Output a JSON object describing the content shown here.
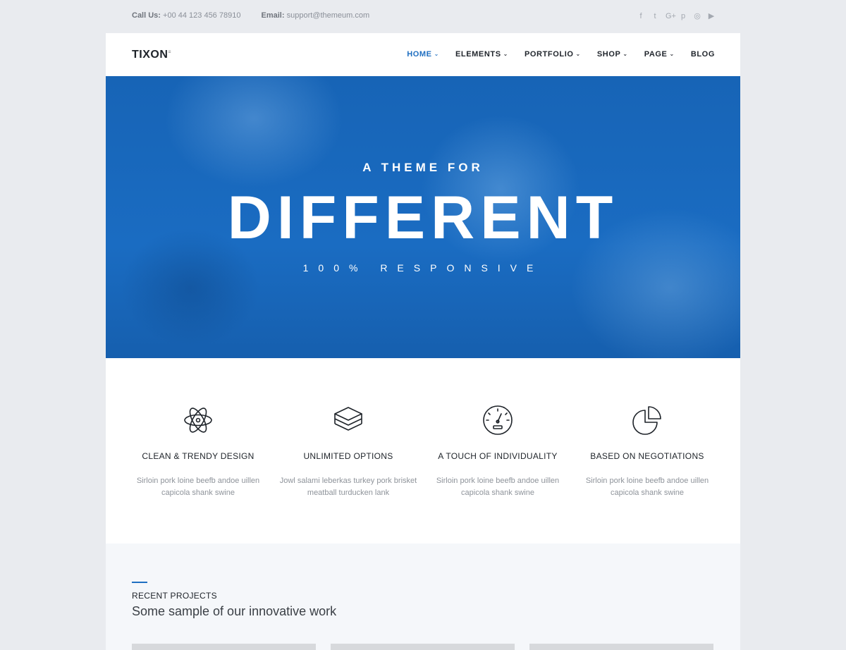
{
  "topbar": {
    "call_label": "Call Us:",
    "call_value": "+00 44 123 456 78910",
    "email_label": "Email:",
    "email_value": "support@themeum.com",
    "socials": [
      "f",
      "t",
      "G+",
      "p",
      "◎",
      "▶"
    ]
  },
  "navbar": {
    "logo": "TIXON",
    "logo_mark": "≡",
    "menu": [
      {
        "label": "HOME",
        "active": true,
        "dropdown": true
      },
      {
        "label": "ELEMENTS",
        "dropdown": true
      },
      {
        "label": "PORTFOLIO",
        "dropdown": true
      },
      {
        "label": "SHOP",
        "dropdown": true
      },
      {
        "label": "PAGE",
        "dropdown": true
      },
      {
        "label": "BLOG",
        "dropdown": false
      }
    ]
  },
  "hero": {
    "sup": "A THEME FOR",
    "title": "DIFFERENT",
    "sub": "100% RESPONSIVE"
  },
  "features": [
    {
      "icon": "atom-icon",
      "title": "CLEAN & TRENDY DESIGN",
      "line1": "Sirloin pork loine beefb andoe uillen",
      "line2": "capicola shank swine"
    },
    {
      "icon": "layers-icon",
      "title": "UNLIMITED OPTIONS",
      "line1": "Jowl salami leberkas turkey pork brisket",
      "line2": "meatball turducken lank"
    },
    {
      "icon": "speedometer-icon",
      "title": "A TOUCH OF INDIVIDUALITY",
      "line1": "Sirloin pork loine beefb andoe uillen",
      "line2": "capicola shank swine"
    },
    {
      "icon": "pie-chart-icon",
      "title": "BASED ON NEGOTIATIONS",
      "line1": "Sirloin pork loine beefb andoe uillen",
      "line2": "capicola shank swine"
    }
  ],
  "projects": {
    "label": "RECENT PROJECTS",
    "heading": "Some sample of our innovative work"
  },
  "colors": {
    "accent": "#1f6fc1",
    "hero_blue": "#1a6cc2",
    "page_bg": "#e9ebef"
  }
}
